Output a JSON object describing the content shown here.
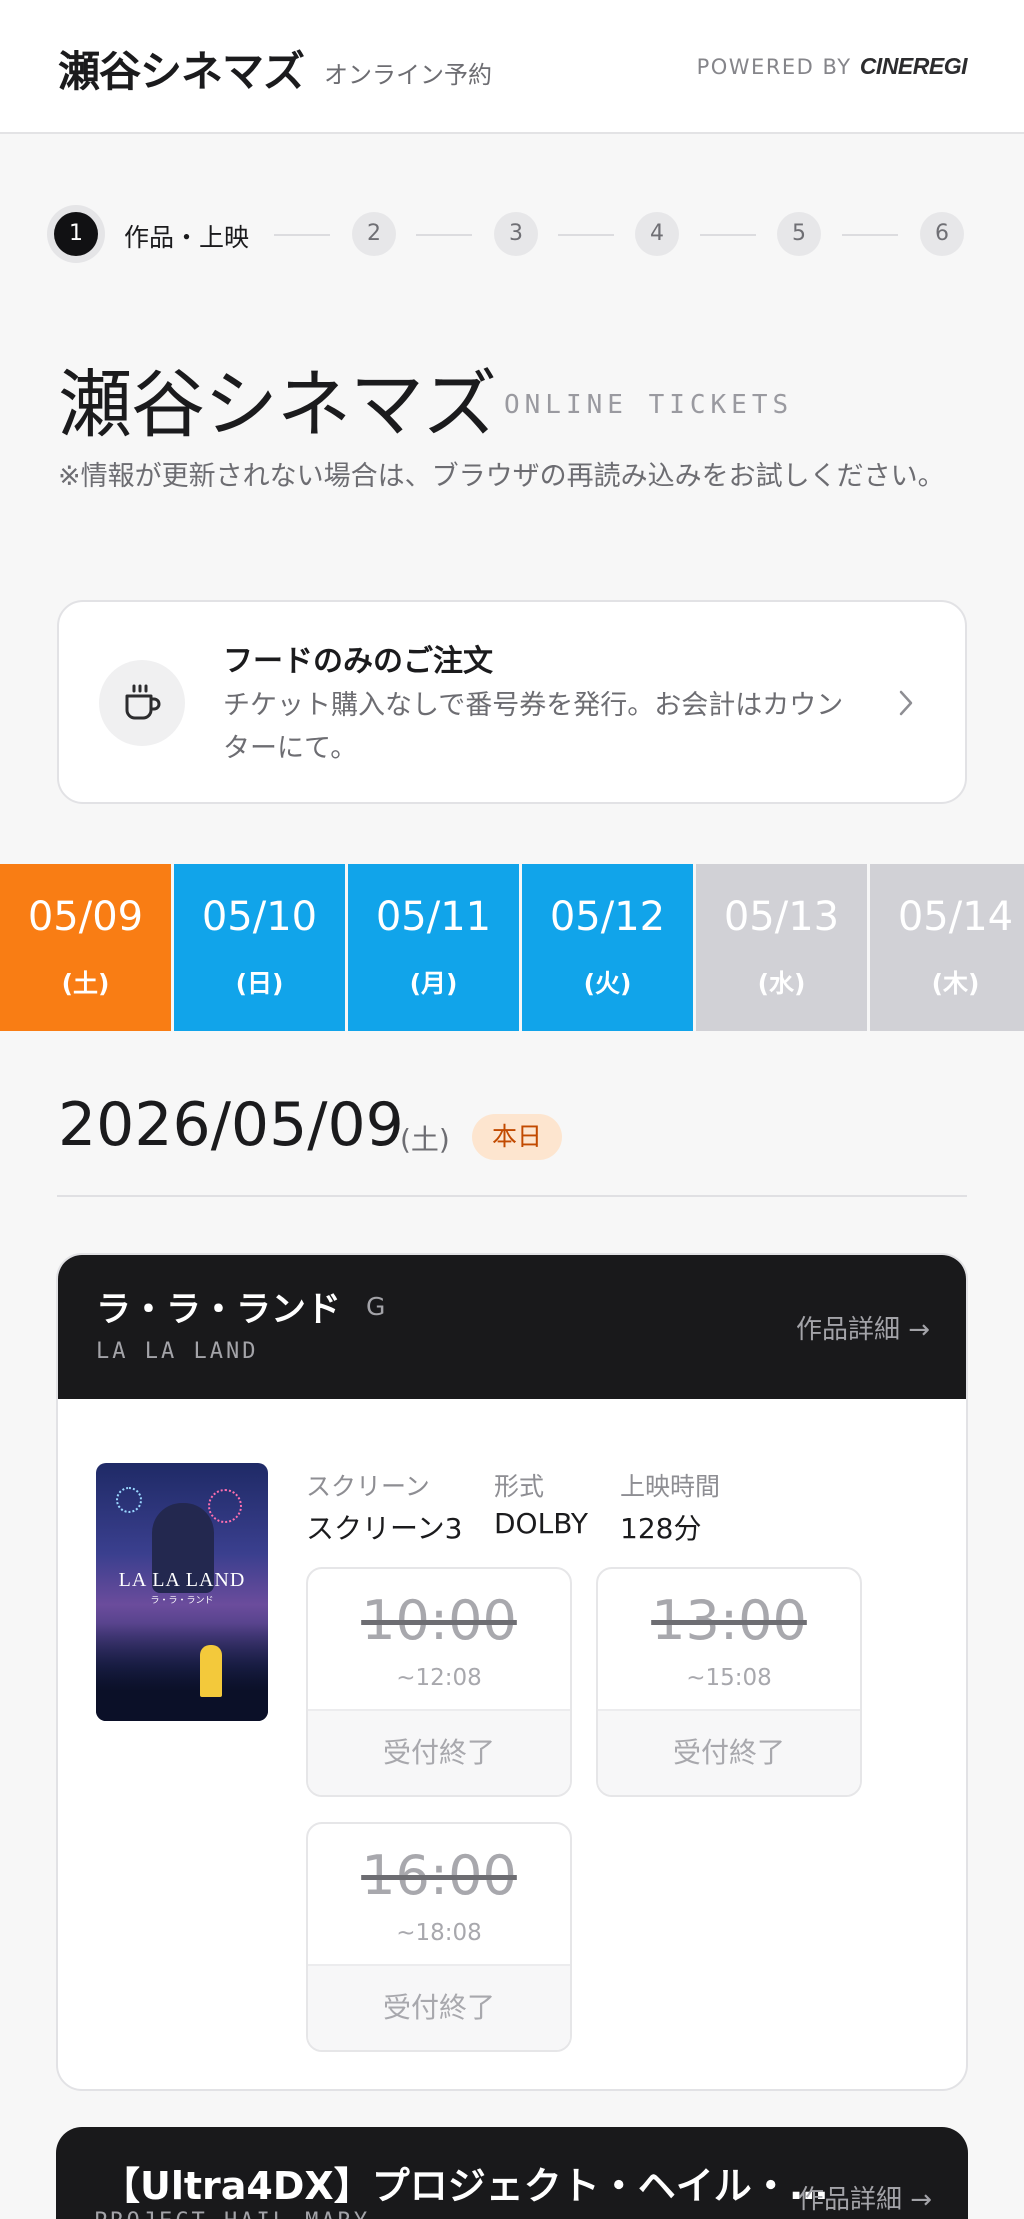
{
  "header": {
    "brand": "瀬谷シネマズ",
    "subtitle": "オンライン予約",
    "powered_prefix": "POWERED BY",
    "powered_brand": "CINEREGI"
  },
  "stepper": {
    "active_step": "1",
    "active_label": "作品・上映",
    "steps": [
      "1",
      "2",
      "3",
      "4",
      "5",
      "6"
    ]
  },
  "page": {
    "title": "瀬谷シネマズ",
    "title_en": "ONLINE TICKETS",
    "notice": "※情報が更新されない場合は、ブラウザの再読み込みをお試しください。"
  },
  "food_order": {
    "title": "フードのみのご注文",
    "description": "チケット購入なしで番号券を発行。お会計はカウンターにて。",
    "icon": "coffee-cup-icon"
  },
  "dates": [
    {
      "date": "05/09",
      "weekday": "(土)",
      "state": "today"
    },
    {
      "date": "05/10",
      "weekday": "(日)",
      "state": "open"
    },
    {
      "date": "05/11",
      "weekday": "(月)",
      "state": "open"
    },
    {
      "date": "05/12",
      "weekday": "(火)",
      "state": "open"
    },
    {
      "date": "05/13",
      "weekday": "(水)",
      "state": "closed"
    },
    {
      "date": "05/14",
      "weekday": "(木)",
      "state": "closed"
    }
  ],
  "colors": {
    "today": "#f97d14",
    "open": "#11a4ea",
    "closed": "#d1d1d6"
  },
  "selected_date": {
    "date": "2026/05/09",
    "weekday": "(土)",
    "badge": "本日"
  },
  "movies": [
    {
      "title": "ラ・ラ・ランド",
      "rating": "G",
      "title_en": "LA LA LAND",
      "detail_link": "作品詳細 →",
      "poster_text": "LA LA LAND",
      "poster_subtext": "ラ・ラ・ランド",
      "info_labels": {
        "screen": "スクリーン",
        "format": "形式",
        "runtime": "上映時間"
      },
      "screen": "スクリーン3",
      "format": "DOLBY",
      "runtime": "128分",
      "showtimes": [
        {
          "start": "10:00",
          "end": "~12:08",
          "status": "受付終了"
        },
        {
          "start": "13:00",
          "end": "~15:08",
          "status": "受付終了"
        },
        {
          "start": "16:00",
          "end": "~18:08",
          "status": "受付終了"
        }
      ]
    },
    {
      "title": "【Ultra4DX】プロジェクト・ヘイル・…",
      "title_en": "PROJECT HAIL MARY",
      "detail_link": "作品詳細 →"
    }
  ]
}
